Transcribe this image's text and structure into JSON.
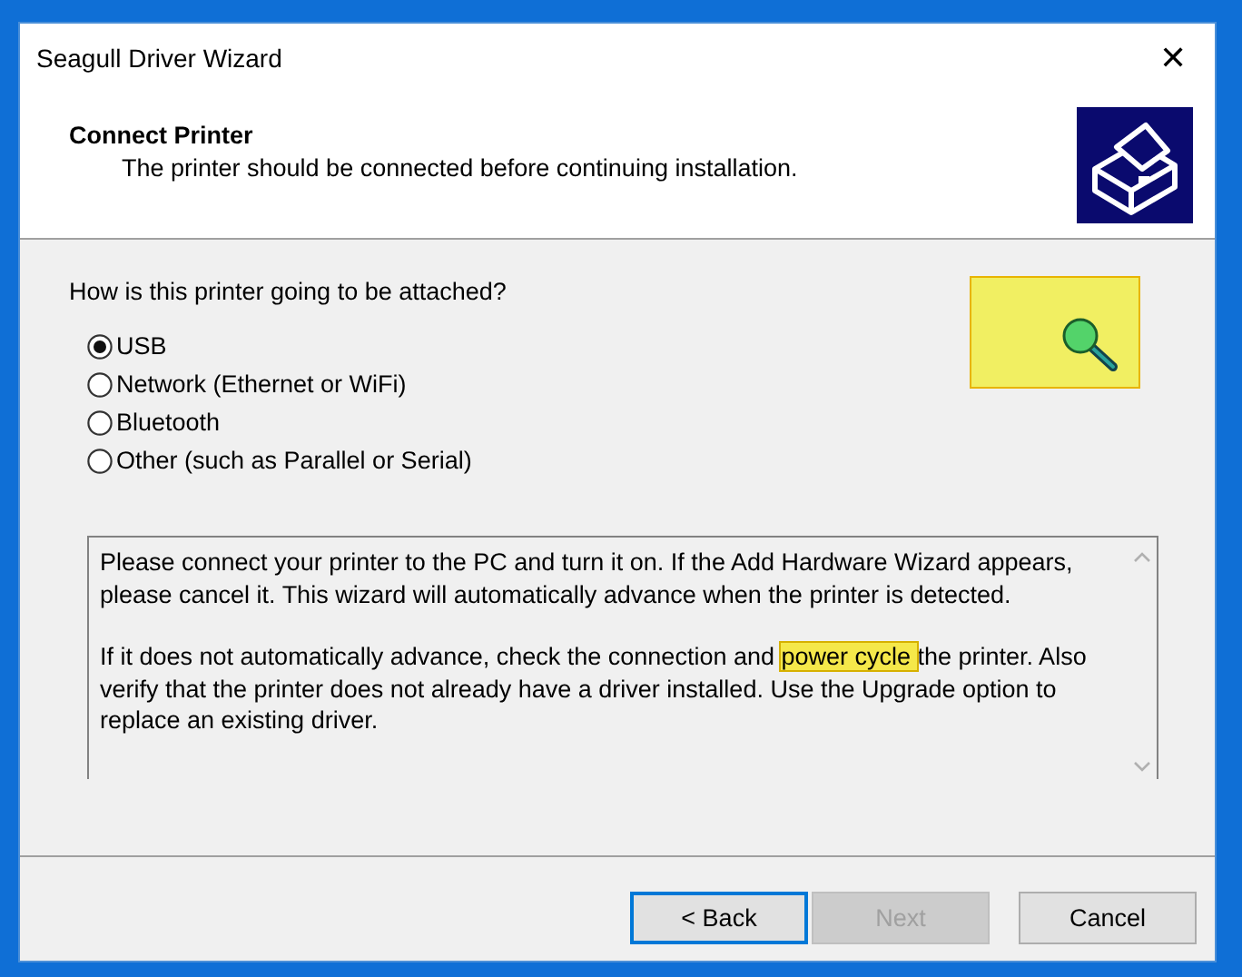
{
  "window": {
    "title": "Seagull Driver Wizard",
    "close": "✕"
  },
  "header": {
    "title": "Connect Printer",
    "subtitle": "The printer should be connected before continuing installation."
  },
  "question": "How is this printer going to be attached?",
  "options": [
    {
      "label": "USB",
      "selected": true
    },
    {
      "label": "Network (Ethernet or WiFi)",
      "selected": false
    },
    {
      "label": "Bluetooth",
      "selected": false
    },
    {
      "label": "Other (such as Parallel or Serial)",
      "selected": false
    }
  ],
  "info": {
    "paragraph_1": "Please connect your printer to the PC and turn it on. If the Add Hardware Wizard appears, please cancel it. This wizard will automatically advance when the printer is detected.",
    "paragraph_2": {
      "before": "If it does not automatically advance, check the connection and ",
      "highlight": "power cycle ",
      "after": "the printer.  Also verify that the printer does not already have a driver installed.  Use the Upgrade option to replace an existing driver."
    }
  },
  "buttons": [
    {
      "label": "< Back",
      "focused": true,
      "disabled": false
    },
    {
      "label": "Next",
      "focused": false,
      "disabled": true
    },
    {
      "label": "Cancel",
      "focused": false,
      "disabled": false
    }
  ]
}
